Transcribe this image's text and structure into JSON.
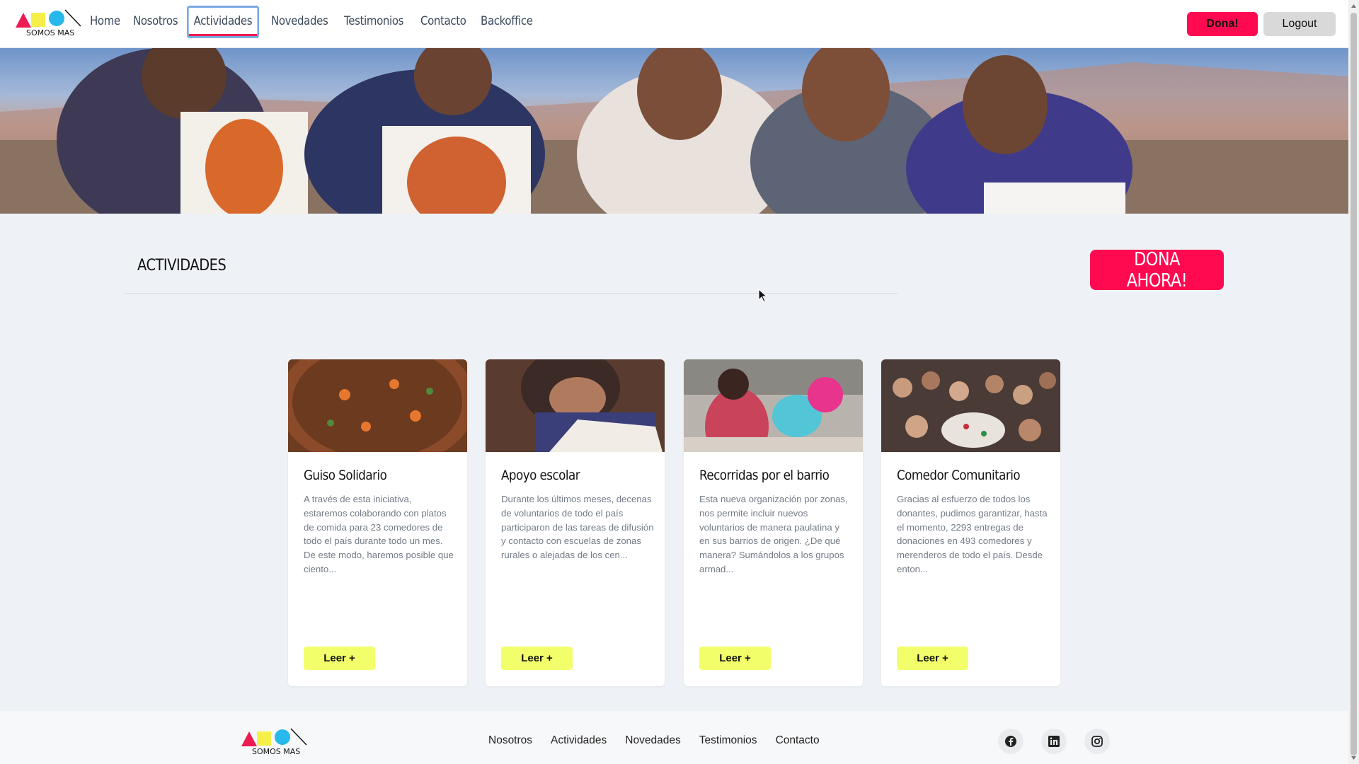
{
  "brand": {
    "name": "SOMOS MAS",
    "colors": {
      "red": "#ec1b52",
      "yellow": "#f5ef4a",
      "blue": "#27b8ec"
    }
  },
  "nav": {
    "links": [
      "Home",
      "Nosotros",
      "Actividades",
      "Novedades",
      "Testimonios",
      "Contacto",
      "Backoffice"
    ],
    "active": "Actividades",
    "dona_label": "Dona!",
    "logout_label": "Logout"
  },
  "section": {
    "title": "ACTIVIDADES",
    "cta_label": "DONA AHORA!"
  },
  "cards": [
    {
      "title": "Guiso Solidario",
      "text": "A través de esta iniciativa, estaremos colaborando con platos de comida para 23 comedores de todo el país durante todo un mes. De este modo, haremos posible que ciento...",
      "button": "Leer +"
    },
    {
      "title": "Apoyo escolar",
      "text": "Durante los últimos meses, decenas de voluntarios de todo el país participaron de las tareas de difusión y contacto con escuelas de zonas rurales o alejadas de los cen...",
      "button": "Leer +"
    },
    {
      "title": "Recorridas por el barrio",
      "text": "Esta nueva organización por zonas, nos permite incluir nuevos voluntarios de manera paulatina y en sus barrios de origen. ¿De qué manera? Sumándolos a los grupos armad...",
      "button": "Leer +"
    },
    {
      "title": "Comedor Comunitario",
      "text": "Gracias al esfuerzo de todos los donantes, pudimos garantizar, hasta el momento, 2293 entregas de donaciones en 493 comedores y merenderos de todo el país. Desde enton...",
      "button": "Leer +"
    }
  ],
  "footer": {
    "links": [
      "Nosotros",
      "Actividades",
      "Novedades",
      "Testimonios",
      "Contacto"
    ],
    "social": [
      "facebook-icon",
      "linkedin-icon",
      "instagram-icon"
    ]
  }
}
